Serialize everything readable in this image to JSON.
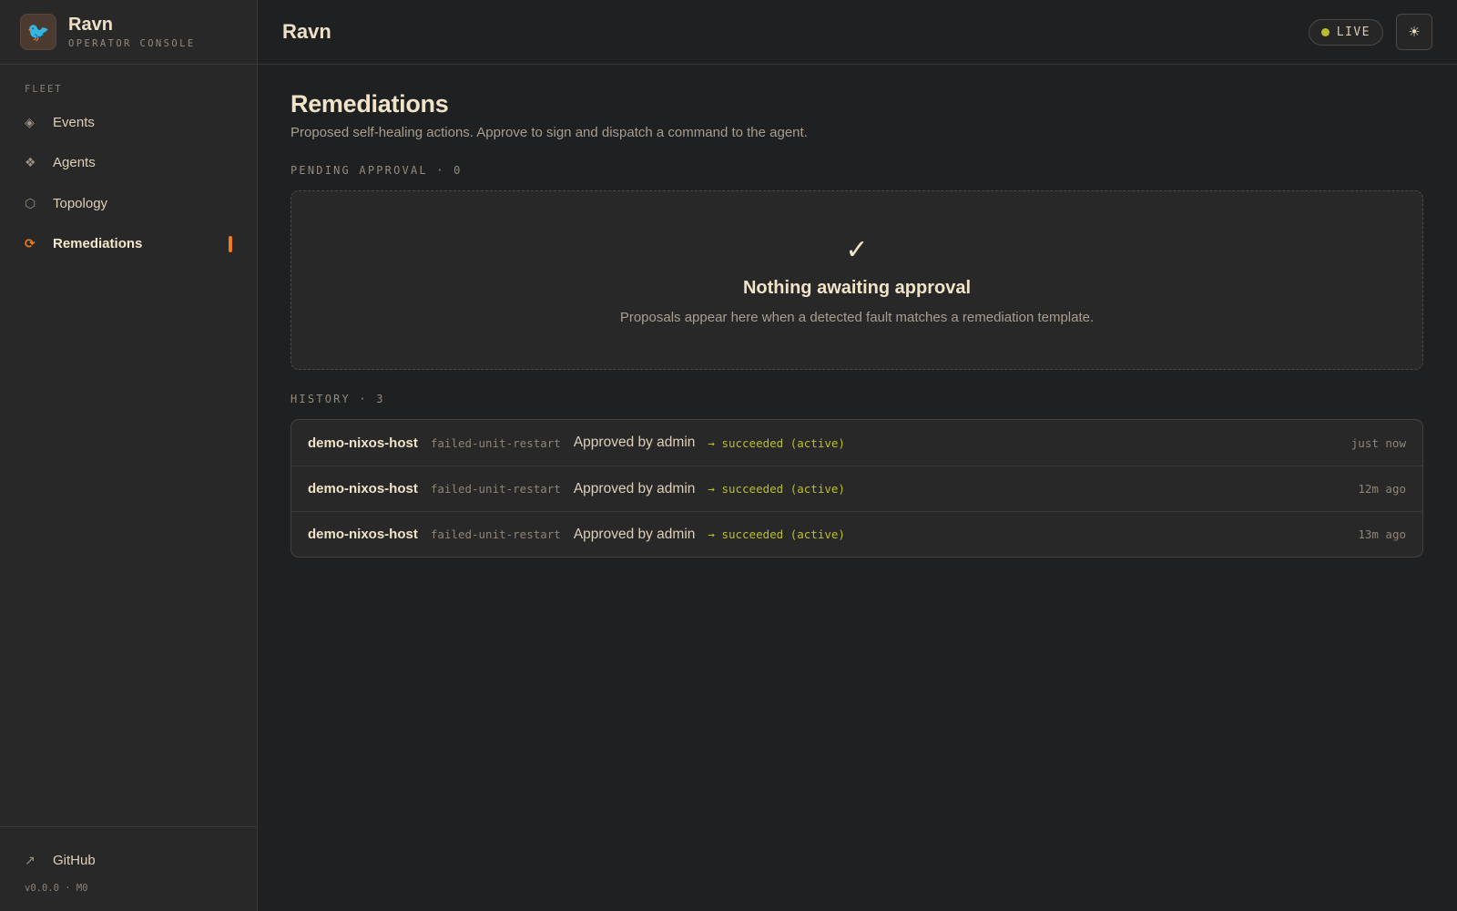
{
  "brand": {
    "logo_glyph": "🐦",
    "title": "Ravn",
    "subtitle": "OPERATOR CONSOLE"
  },
  "sidebar": {
    "section_label": "FLEET",
    "items": [
      {
        "label": "Events",
        "icon": "◈",
        "icon_name": "diamond-icon"
      },
      {
        "label": "Agents",
        "icon": "❖",
        "icon_name": "agents-icon"
      },
      {
        "label": "Topology",
        "icon": "⬡",
        "icon_name": "hexagon-icon"
      },
      {
        "label": "Remediations",
        "icon": "⟳",
        "icon_name": "refresh-icon",
        "active": true
      }
    ],
    "github": {
      "label": "GitHub",
      "icon": "↗"
    },
    "version": "v0.0.0 · M0"
  },
  "topbar": {
    "title": "Ravn",
    "live_label": "LIVE",
    "theme_icon": "☀"
  },
  "page": {
    "title": "Remediations",
    "description": "Proposed self-healing actions. Approve to sign and dispatch a command to the agent.",
    "pending_label": "PENDING APPROVAL · 0",
    "empty": {
      "icon": "✓",
      "title": "Nothing awaiting approval",
      "description": "Proposals appear here when a detected fault matches a remediation template."
    },
    "history_label": "HISTORY · 3",
    "history": [
      {
        "host": "demo-nixos-host",
        "template": "failed-unit-restart",
        "approval": "Approved by admin",
        "status": "→ succeeded (active)",
        "time": "just now"
      },
      {
        "host": "demo-nixos-host",
        "template": "failed-unit-restart",
        "approval": "Approved by admin",
        "status": "→ succeeded (active)",
        "time": "12m ago"
      },
      {
        "host": "demo-nixos-host",
        "template": "failed-unit-restart",
        "approval": "Approved by admin",
        "status": "→ succeeded (active)",
        "time": "13m ago"
      }
    ]
  },
  "colors": {
    "accent": "#f07b1e",
    "live": "#b9bf2a",
    "background": "#1e2021",
    "sidebar": "#282828"
  }
}
